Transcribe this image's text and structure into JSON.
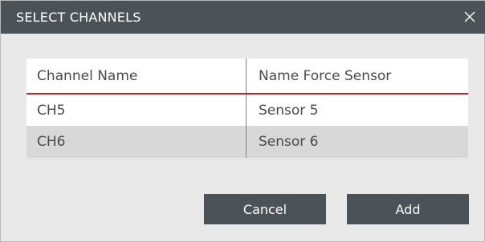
{
  "dialog": {
    "title": "SELECT CHANNELS",
    "close_icon": "close-icon"
  },
  "table": {
    "columns": [
      "Channel Name",
      "Name Force Sensor"
    ],
    "rows": [
      [
        "CH5",
        "Sensor 5"
      ],
      [
        "CH6",
        "Sensor 6"
      ]
    ],
    "header_underline_color": "#c8201e"
  },
  "buttons": {
    "cancel_label": "Cancel",
    "add_label": "Add"
  },
  "colors": {
    "titlebar": "#4b5359",
    "button": "#4b5359",
    "background": "#e9e9e9",
    "selected_row": "#d8d8d8"
  }
}
